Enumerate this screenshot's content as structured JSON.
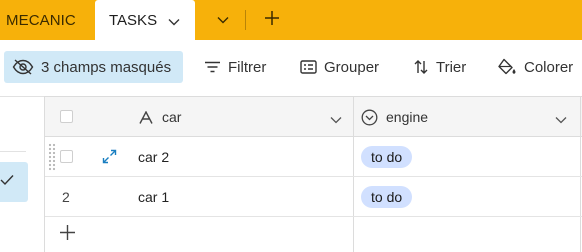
{
  "tabs": {
    "inactive_label": "MECANIC",
    "active_label": "TASKS"
  },
  "toolbar": {
    "hidden_fields_label": "3 champs masqués",
    "filter_label": "Filtrer",
    "group_label": "Grouper",
    "sort_label": "Trier",
    "color_label": "Colorer"
  },
  "grid": {
    "columns": [
      {
        "name": "car",
        "type_icon": "text-field-icon"
      },
      {
        "name": "engine",
        "type_icon": "single-select-icon"
      }
    ],
    "rows": [
      {
        "row_label": "",
        "car": "car 2",
        "engine": "to do"
      },
      {
        "row_label": "2",
        "car": "car 1",
        "engine": "to do"
      }
    ]
  },
  "colors": {
    "topbar": "#f7b10a",
    "selection_blue": "#d1e9f7",
    "pill_blue": "#d1e0ff",
    "expand_icon": "#1a7fc1"
  }
}
